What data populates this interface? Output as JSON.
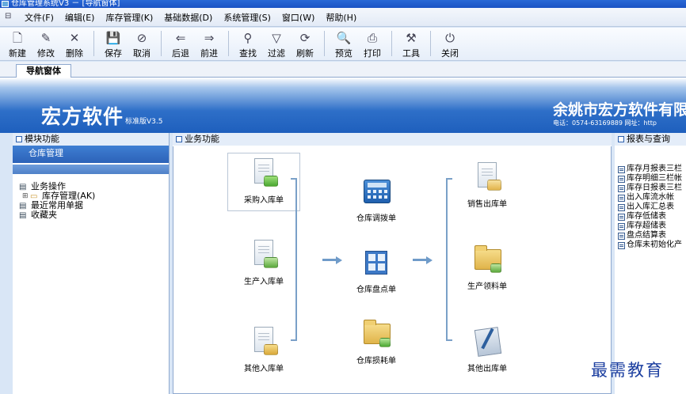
{
  "window": {
    "title": "仓库管理系统V3 － [导航窗体]"
  },
  "menu": {
    "items": [
      "文件(F)",
      "编辑(E)",
      "库存管理(K)",
      "基础数据(D)",
      "系统管理(S)",
      "窗口(W)",
      "帮助(H)"
    ]
  },
  "toolbar": {
    "buttons": [
      {
        "label": "新建",
        "icon": "new-doc-icon",
        "glyph": "🗋"
      },
      {
        "label": "修改",
        "icon": "edit-icon",
        "glyph": "✎"
      },
      {
        "label": "删除",
        "icon": "delete-icon",
        "glyph": "✕"
      },
      {
        "label": "保存",
        "icon": "save-icon",
        "glyph": "💾"
      },
      {
        "label": "取消",
        "icon": "cancel-icon",
        "glyph": "⊘"
      },
      {
        "label": "后退",
        "icon": "back-icon",
        "glyph": "⇐"
      },
      {
        "label": "前进",
        "icon": "forward-icon",
        "glyph": "⇒"
      },
      {
        "label": "查找",
        "icon": "find-icon",
        "glyph": "⚲"
      },
      {
        "label": "过滤",
        "icon": "filter-icon",
        "glyph": "▽"
      },
      {
        "label": "刷新",
        "icon": "refresh-icon",
        "glyph": "⟳"
      },
      {
        "label": "预览",
        "icon": "preview-icon",
        "glyph": "🔍"
      },
      {
        "label": "打印",
        "icon": "print-icon",
        "glyph": "⎙"
      },
      {
        "label": "工具",
        "icon": "tools-icon",
        "glyph": "⚒"
      },
      {
        "label": "关闭",
        "icon": "close-icon",
        "glyph": "⏻"
      }
    ]
  },
  "tabs": {
    "active": "导航窗体"
  },
  "banner": {
    "brand": "宏方软件",
    "version": "标准版V3.5",
    "company": "余姚市宏方软件有限",
    "contact": "电话：0574-63169889    网址：http"
  },
  "left_panel": {
    "title": "模块功能",
    "section": "仓库管理",
    "tree": [
      {
        "label": "业务操作",
        "level": 0,
        "icon": "book-icon"
      },
      {
        "label": "库存管理(AK)",
        "level": 1,
        "icon": "folder-icon"
      },
      {
        "label": "最近常用单据",
        "level": 0,
        "icon": "book-icon"
      },
      {
        "label": "收藏夹",
        "level": 0,
        "icon": "book-icon"
      }
    ]
  },
  "center_panel": {
    "title": "业务功能",
    "functions": {
      "purchase_in": "采购入库单",
      "production_in": "生产入库单",
      "other_in": "其他入库单",
      "transfer": "仓库调拨单",
      "stocktake": "仓库盘点单",
      "loss": "仓库损耗单",
      "sales_out": "销售出库单",
      "production_pick": "生产领料单",
      "other_out": "其他出库单"
    }
  },
  "right_panel": {
    "title": "报表与查询",
    "reports": [
      "库存月报表三栏",
      "库存明细三栏帐",
      "库存日报表三栏",
      "出入库流水帐",
      "出入库汇总表",
      "库存低储表",
      "库存超储表",
      "盘点结算表",
      "仓库未初始化产"
    ]
  },
  "watermark": "最需教育"
}
